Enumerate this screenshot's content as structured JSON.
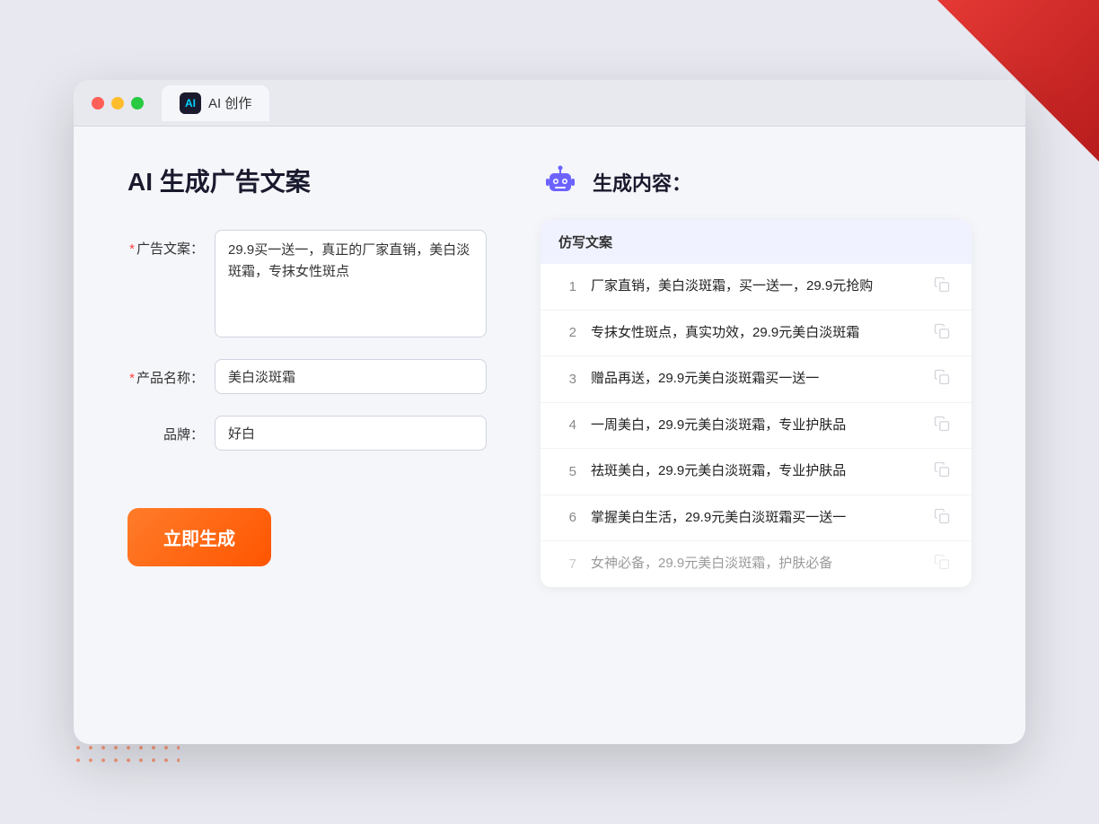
{
  "browser": {
    "tab_label": "AI 创作",
    "tab_icon_text": "AI"
  },
  "left_panel": {
    "title": "AI 生成广告文案",
    "ad_copy_label": "广告文案：",
    "ad_copy_required": "*",
    "ad_copy_value": "29.9买一送一，真正的厂家直销，美白淡斑霜，专抹女性斑点",
    "product_name_label": "产品名称：",
    "product_name_required": "*",
    "product_name_value": "美白淡斑霜",
    "brand_label": "品牌：",
    "brand_value": "好白",
    "generate_btn_label": "立即生成"
  },
  "right_panel": {
    "title": "生成内容：",
    "table_header": "仿写文案",
    "rows": [
      {
        "num": "1",
        "text": "厂家直销，美白淡斑霜，买一送一，29.9元抢购",
        "muted": false
      },
      {
        "num": "2",
        "text": "专抹女性斑点，真实功效，29.9元美白淡斑霜",
        "muted": false
      },
      {
        "num": "3",
        "text": "赠品再送，29.9元美白淡斑霜买一送一",
        "muted": false
      },
      {
        "num": "4",
        "text": "一周美白，29.9元美白淡斑霜，专业护肤品",
        "muted": false
      },
      {
        "num": "5",
        "text": "祛斑美白，29.9元美白淡斑霜，专业护肤品",
        "muted": false
      },
      {
        "num": "6",
        "text": "掌握美白生活，29.9元美白淡斑霜买一送一",
        "muted": false
      },
      {
        "num": "7",
        "text": "女神必备，29.9元美白淡斑霜，护肤必备",
        "muted": true
      }
    ]
  }
}
